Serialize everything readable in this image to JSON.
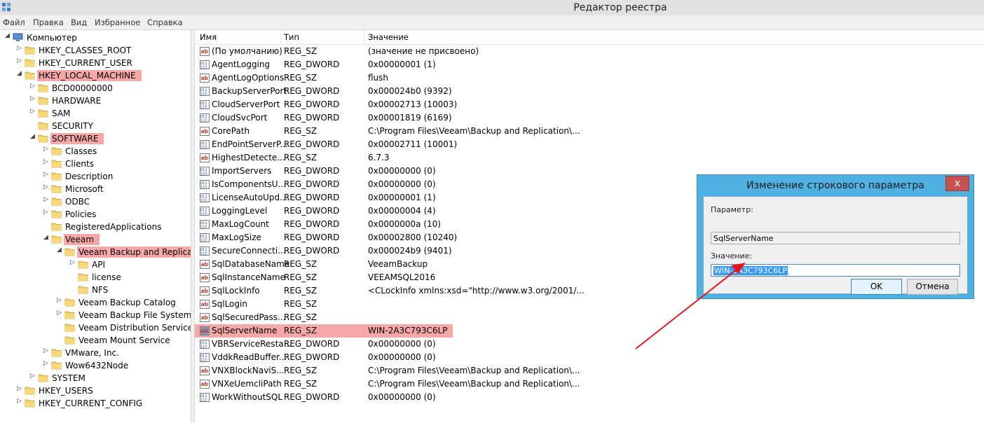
{
  "window": {
    "title": "Редактор реестра"
  },
  "menu": [
    "Файл",
    "Правка",
    "Вид",
    "Избранное",
    "Справка"
  ],
  "tree": [
    {
      "label": "Компьютер",
      "depth": 0,
      "state": "open",
      "icon": "computer"
    },
    {
      "label": "HKEY_CLASSES_ROOT",
      "depth": 1,
      "state": "closed"
    },
    {
      "label": "HKEY_CURRENT_USER",
      "depth": 1,
      "state": "closed"
    },
    {
      "label": "HKEY_LOCAL_MACHINE",
      "depth": 1,
      "state": "open",
      "highlight": true
    },
    {
      "label": "BCD00000000",
      "depth": 2,
      "state": "closed"
    },
    {
      "label": "HARDWARE",
      "depth": 2,
      "state": "closed"
    },
    {
      "label": "SAM",
      "depth": 2,
      "state": "closed"
    },
    {
      "label": "SECURITY",
      "depth": 2,
      "state": "none"
    },
    {
      "label": "SOFTWARE",
      "depth": 2,
      "state": "open",
      "highlight": true
    },
    {
      "label": "Classes",
      "depth": 3,
      "state": "closed"
    },
    {
      "label": "Clients",
      "depth": 3,
      "state": "closed"
    },
    {
      "label": "Description",
      "depth": 3,
      "state": "closed"
    },
    {
      "label": "Microsoft",
      "depth": 3,
      "state": "closed"
    },
    {
      "label": "ODBC",
      "depth": 3,
      "state": "closed"
    },
    {
      "label": "Policies",
      "depth": 3,
      "state": "closed"
    },
    {
      "label": "RegisteredApplications",
      "depth": 3,
      "state": "none"
    },
    {
      "label": "Veeam",
      "depth": 3,
      "state": "open",
      "highlight": true
    },
    {
      "label": "Veeam Backup and Replication",
      "depth": 4,
      "state": "open",
      "highlight": true,
      "icon": "open-folder"
    },
    {
      "label": "API",
      "depth": 5,
      "state": "closed"
    },
    {
      "label": "license",
      "depth": 5,
      "state": "none"
    },
    {
      "label": "NFS",
      "depth": 5,
      "state": "none"
    },
    {
      "label": "Veeam Backup Catalog",
      "depth": 4,
      "state": "closed"
    },
    {
      "label": "Veeam Backup File System VSS Integration",
      "depth": 4,
      "state": "closed"
    },
    {
      "label": "Veeam Distribution Service",
      "depth": 4,
      "state": "none"
    },
    {
      "label": "Veeam Mount Service",
      "depth": 4,
      "state": "none"
    },
    {
      "label": "VMware, Inc.",
      "depth": 3,
      "state": "closed"
    },
    {
      "label": "Wow6432Node",
      "depth": 3,
      "state": "closed"
    },
    {
      "label": "SYSTEM",
      "depth": 2,
      "state": "closed"
    },
    {
      "label": "HKEY_USERS",
      "depth": 1,
      "state": "closed"
    },
    {
      "label": "HKEY_CURRENT_CONFIG",
      "depth": 1,
      "state": "closed"
    }
  ],
  "columns": {
    "name": "Имя",
    "type": "Тип",
    "value": "Значение"
  },
  "values": [
    {
      "name": "(По умолчанию)",
      "type": "REG_SZ",
      "value": "(значение не присвоено)",
      "icon": "string"
    },
    {
      "name": "AgentLogging",
      "type": "REG_DWORD",
      "value": "0x00000001 (1)",
      "icon": "binary"
    },
    {
      "name": "AgentLogOptions",
      "type": "REG_SZ",
      "value": "flush",
      "icon": "string"
    },
    {
      "name": "BackupServerPort",
      "type": "REG_DWORD",
      "value": "0x000024b0 (9392)",
      "icon": "binary"
    },
    {
      "name": "CloudServerPort",
      "type": "REG_DWORD",
      "value": "0x00002713 (10003)",
      "icon": "binary"
    },
    {
      "name": "CloudSvcPort",
      "type": "REG_DWORD",
      "value": "0x00001819 (6169)",
      "icon": "binary"
    },
    {
      "name": "CorePath",
      "type": "REG_SZ",
      "value": "C:\\Program Files\\Veeam\\Backup and Replication\\...",
      "icon": "string"
    },
    {
      "name": "EndPointServerP...",
      "type": "REG_DWORD",
      "value": "0x00002711 (10001)",
      "icon": "binary"
    },
    {
      "name": "HighestDetecte...",
      "type": "REG_SZ",
      "value": "6.7.3",
      "icon": "string"
    },
    {
      "name": "ImportServers",
      "type": "REG_DWORD",
      "value": "0x00000000 (0)",
      "icon": "binary"
    },
    {
      "name": "IsComponentsU...",
      "type": "REG_DWORD",
      "value": "0x00000000 (0)",
      "icon": "binary"
    },
    {
      "name": "LicenseAutoUpd...",
      "type": "REG_DWORD",
      "value": "0x00000001 (1)",
      "icon": "binary"
    },
    {
      "name": "LoggingLevel",
      "type": "REG_DWORD",
      "value": "0x00000004 (4)",
      "icon": "binary"
    },
    {
      "name": "MaxLogCount",
      "type": "REG_DWORD",
      "value": "0x0000000a (10)",
      "icon": "binary"
    },
    {
      "name": "MaxLogSize",
      "type": "REG_DWORD",
      "value": "0x00002800 (10240)",
      "icon": "binary"
    },
    {
      "name": "SecureConnecti...",
      "type": "REG_DWORD",
      "value": "0x000024b9 (9401)",
      "icon": "binary"
    },
    {
      "name": "SqlDatabaseName",
      "type": "REG_SZ",
      "value": "VeeamBackup",
      "icon": "string"
    },
    {
      "name": "SqlInstanceName",
      "type": "REG_SZ",
      "value": "VEEAMSQL2016",
      "icon": "string"
    },
    {
      "name": "SqlLockInfo",
      "type": "REG_SZ",
      "value": "<CLockInfo xmlns:xsd=\"http://www.w3.org/2001/...",
      "icon": "string"
    },
    {
      "name": "SqlLogin",
      "type": "REG_SZ",
      "value": "",
      "icon": "string"
    },
    {
      "name": "SqlSecuredPass...",
      "type": "REG_SZ",
      "value": "",
      "icon": "string"
    },
    {
      "name": "SqlServerName",
      "type": "REG_SZ",
      "value": "WIN-2A3C793C6LP",
      "icon": "string",
      "highlight": true,
      "selected": true
    },
    {
      "name": "VBRServiceResta...",
      "type": "REG_DWORD",
      "value": "0x00000000 (0)",
      "icon": "binary"
    },
    {
      "name": "VddkReadBuffer...",
      "type": "REG_DWORD",
      "value": "0x00000000 (0)",
      "icon": "binary"
    },
    {
      "name": "VNXBlockNaviS...",
      "type": "REG_SZ",
      "value": "C:\\Program Files\\Veeam\\Backup and Replication\\...",
      "icon": "string"
    },
    {
      "name": "VNXeUemcliPath",
      "type": "REG_SZ",
      "value": "C:\\Program Files\\Veeam\\Backup and Replication\\...",
      "icon": "string"
    },
    {
      "name": "WorkWithoutSQL",
      "type": "REG_DWORD",
      "value": "0x00000000 (0)",
      "icon": "binary"
    }
  ],
  "dialog": {
    "title": "Изменение строкового параметра",
    "close": "x",
    "name_label": "Параметр:",
    "name_value": "SqlServerName",
    "value_label": "Значение:",
    "value": "WIN-2A3C793C6LP",
    "ok": "OK",
    "cancel": "Отмена"
  },
  "colors": {
    "highlight": "#f6a8a8",
    "dialog_frame": "#4fb0e2",
    "annotation_arrow": "#e8161b",
    "selection": "#3399ff"
  }
}
